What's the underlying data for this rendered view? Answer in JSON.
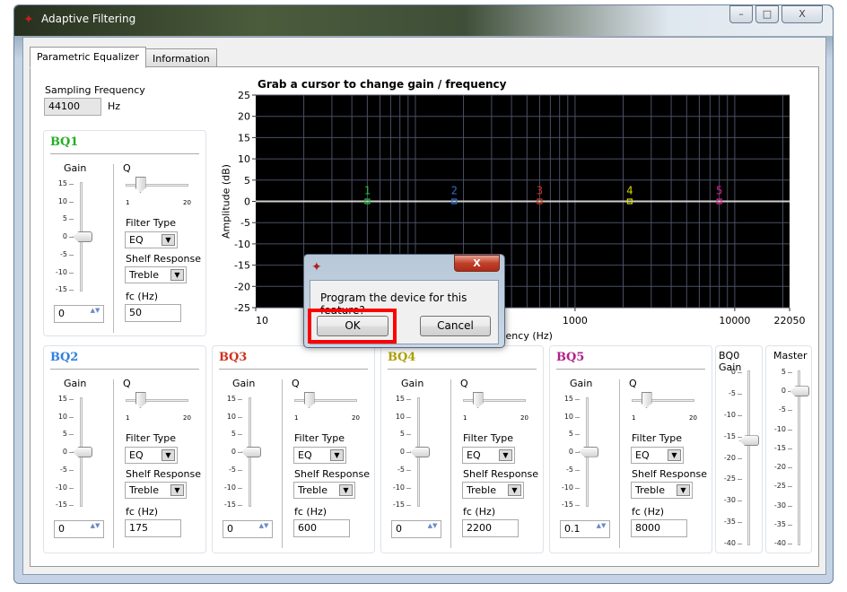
{
  "window": {
    "title": "Adaptive Filtering",
    "minimize": "–",
    "maximize": "□",
    "close": "X"
  },
  "tabs": [
    {
      "label": "Parametric Equalizer",
      "active": true
    },
    {
      "label": "Information",
      "active": false
    }
  ],
  "sampling": {
    "label": "Sampling Frequency",
    "value": "44100",
    "unit": "Hz"
  },
  "chart_data": {
    "type": "line",
    "title": "Grab a cursor to change gain / frequency",
    "xlabel": "Frequency (Hz)",
    "ylabel": "Amplitude (dB)",
    "xscale": "log",
    "xlim": [
      10,
      22050
    ],
    "ylim": [
      -25,
      25
    ],
    "xticks": [
      "10",
      "1000",
      "10000",
      "22050"
    ],
    "yticks": [
      "25",
      "20",
      "15",
      "10",
      "5",
      "0",
      "-5",
      "-10",
      "-15",
      "-20",
      "-25"
    ],
    "grid": true,
    "background": "#000000",
    "grid_color": "#4a4f66",
    "series": [
      {
        "x": [
          10,
          22050
        ],
        "y": [
          0,
          0
        ],
        "color": "#d0d0d0"
      }
    ],
    "cursors": [
      {
        "label": "1",
        "x": 50,
        "y": 0,
        "color": "#22c03a"
      },
      {
        "label": "2",
        "x": 175,
        "y": 0,
        "color": "#2f6fd0"
      },
      {
        "label": "3",
        "x": 600,
        "y": 0,
        "color": "#d0321c"
      },
      {
        "label": "4",
        "x": 2200,
        "y": 0,
        "color": "#d8d800"
      },
      {
        "label": "5",
        "x": 8000,
        "y": 0,
        "color": "#e0209a"
      }
    ]
  },
  "bands": [
    {
      "title": "BQ1",
      "color": "#22b022",
      "gain_label": "Gain",
      "gain": "0",
      "q_label": "Q",
      "q_min": "1",
      "q_max": "20",
      "q_level": 0.25,
      "filter_type_label": "Filter Type",
      "filter_type": "EQ",
      "shelf_label": "Shelf Response",
      "shelf": "Treble",
      "fc_label": "fc (Hz)",
      "fc": "50"
    },
    {
      "title": "BQ2",
      "color": "#2f7fe0",
      "gain_label": "Gain",
      "gain": "0",
      "q_label": "Q",
      "q_min": "1",
      "q_max": "20",
      "q_level": 0.25,
      "filter_type_label": "Filter Type",
      "filter_type": "EQ",
      "shelf_label": "Shelf Response",
      "shelf": "Treble",
      "fc_label": "fc (Hz)",
      "fc": "175"
    },
    {
      "title": "BQ3",
      "color": "#d0321c",
      "gain_label": "Gain",
      "gain": "0",
      "q_label": "Q",
      "q_min": "1",
      "q_max": "20",
      "q_level": 0.25,
      "filter_type_label": "Filter Type",
      "filter_type": "EQ",
      "shelf_label": "Shelf Response",
      "shelf": "Treble",
      "fc_label": "fc (Hz)",
      "fc": "600"
    },
    {
      "title": "BQ4",
      "color": "#b0a000",
      "gain_label": "Gain",
      "gain": "0",
      "q_label": "Q",
      "q_min": "1",
      "q_max": "20",
      "q_level": 0.25,
      "filter_type_label": "Filter Type",
      "filter_type": "EQ",
      "shelf_label": "Shelf Response",
      "shelf": "Treble",
      "fc_label": "fc (Hz)",
      "fc": "2200"
    },
    {
      "title": "BQ5",
      "color": "#b0208a",
      "gain_label": "Gain",
      "gain": "0.1",
      "q_label": "Q",
      "q_min": "1",
      "q_max": "20",
      "q_level": 0.25,
      "filter_type_label": "Filter Type",
      "filter_type": "EQ",
      "shelf_label": "Shelf Response",
      "shelf": "Treble",
      "fc_label": "fc (Hz)",
      "fc": "8000"
    }
  ],
  "gain_ticks": [
    "15",
    "10",
    "5",
    "0",
    "-5",
    "-10",
    "-15"
  ],
  "bq0": {
    "label": "BQ0 Gain",
    "ticks": [
      "0",
      "-5",
      "-10",
      "-15",
      "-20",
      "-25",
      "-30",
      "-35",
      "-40"
    ],
    "value": -16
  },
  "master": {
    "label": "Master",
    "ticks": [
      "5",
      "0",
      "-5",
      "-10",
      "-15",
      "-20",
      "-25",
      "-30",
      "-35",
      "-40"
    ],
    "value": 0
  },
  "dialog": {
    "message": "Program the device for this feature?",
    "ok": "OK",
    "cancel": "Cancel",
    "close": "X",
    "highlight_color": "#ff0000"
  }
}
